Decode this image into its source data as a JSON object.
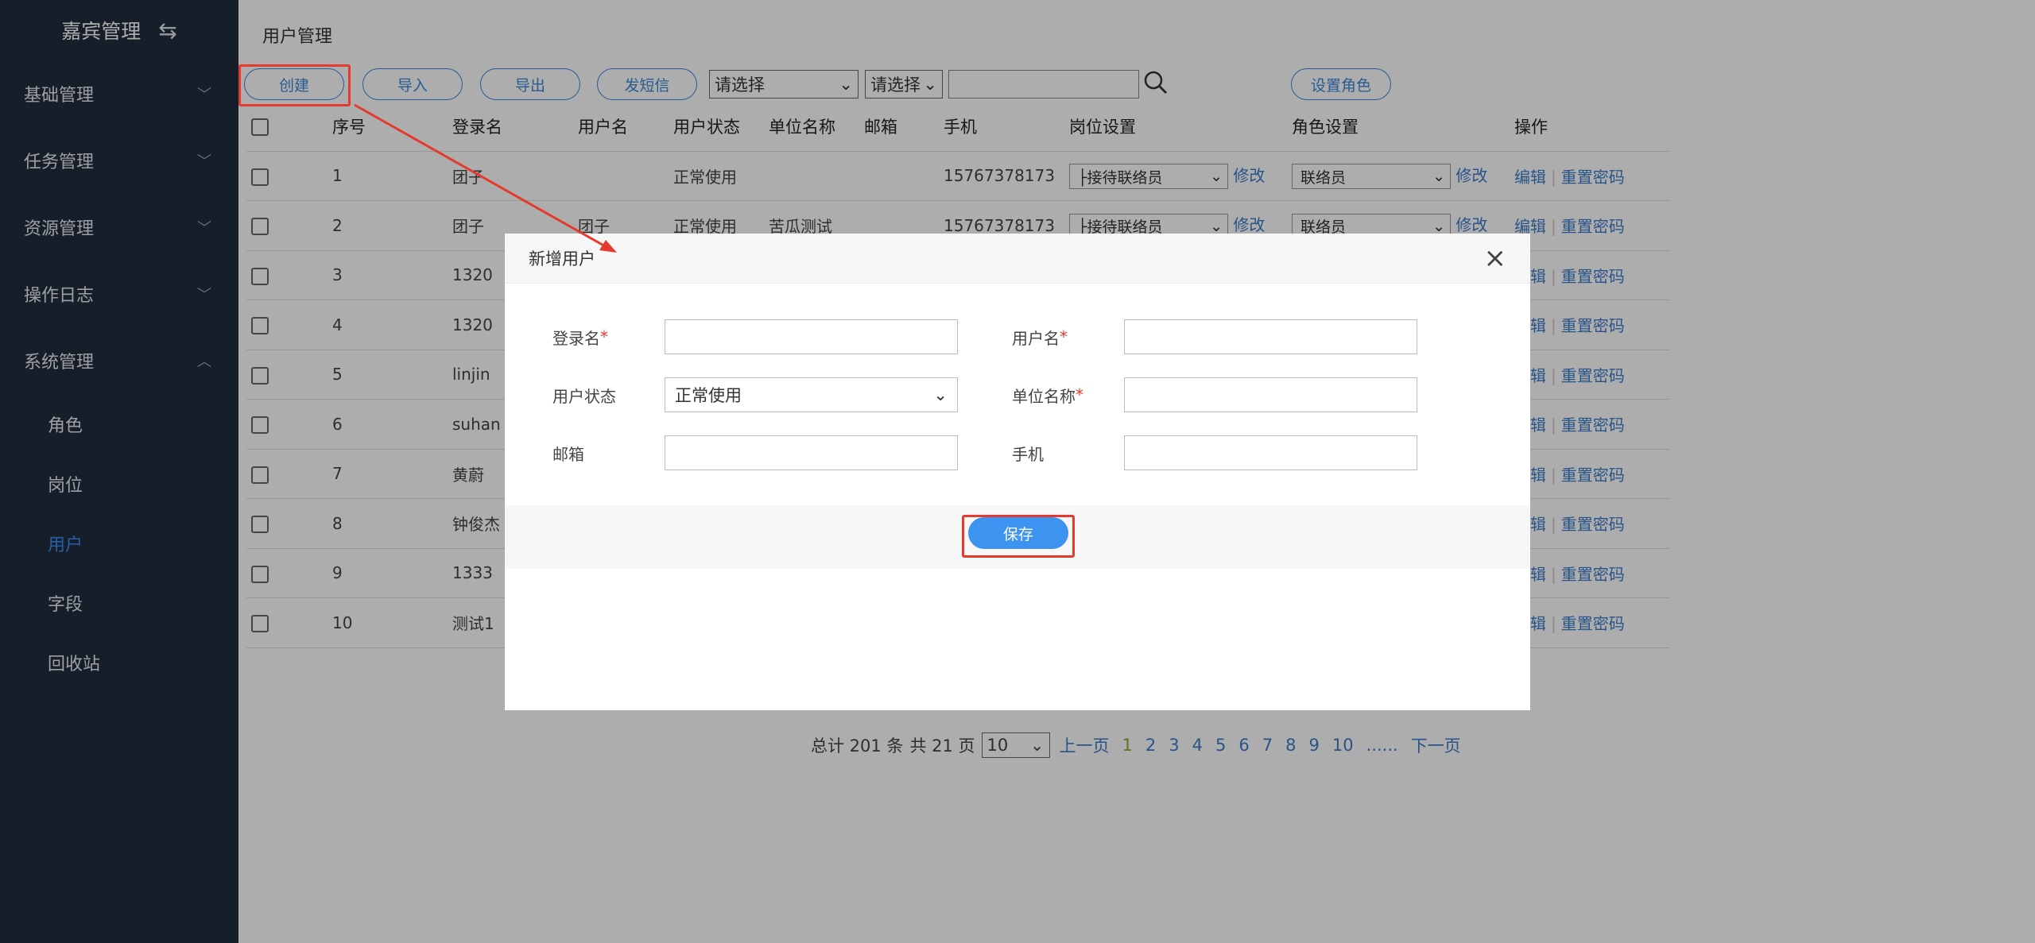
{
  "sidebar": {
    "brand": "嘉宾管理",
    "brand_icon": "swap-icon",
    "menus": [
      {
        "label": "基础管理",
        "icon": "chevron-down-icon"
      },
      {
        "label": "任务管理",
        "icon": "chevron-down-icon"
      },
      {
        "label": "资源管理",
        "icon": "chevron-down-icon"
      },
      {
        "label": "操作日志",
        "icon": "chevron-down-icon"
      },
      {
        "label": "系统管理",
        "icon": "chevron-up-icon"
      }
    ],
    "submenu": [
      "角色",
      "岗位",
      "用户",
      "字段",
      "回收站"
    ],
    "active_submenu": "用户",
    "active_color": "#3d8cf5"
  },
  "page": {
    "title": "用户管理"
  },
  "toolbar": {
    "create": "创建",
    "import": "导入",
    "export": "导出",
    "sms": "发短信",
    "select1": "请选择",
    "select2": "请选择",
    "search_value": "",
    "set_role": "设置角色"
  },
  "table": {
    "headers": [
      "序号",
      "登录名",
      "用户名",
      "用户状态",
      "单位名称",
      "邮箱",
      "手机",
      "岗位设置",
      "角色设置",
      "操作"
    ],
    "rows": [
      {
        "no": "1",
        "login": "团子",
        "name": "",
        "status": "正常使用",
        "unit": "",
        "email": "",
        "phone": "15767378173",
        "post": "├接待联络员",
        "role": "联络员"
      },
      {
        "no": "2",
        "login": "团子",
        "name": "团子",
        "status": "正常使用",
        "unit": "苦瓜测试",
        "email": "",
        "phone": "15767378173",
        "post": "├接待联络员",
        "role": "联络员"
      },
      {
        "no": "3",
        "login": "1320",
        "name": "",
        "status": "",
        "unit": "",
        "email": "",
        "phone": "",
        "post": "",
        "role": ""
      },
      {
        "no": "4",
        "login": "1320",
        "name": "",
        "status": "",
        "unit": "",
        "email": "",
        "phone": "",
        "post": "",
        "role": ""
      },
      {
        "no": "5",
        "login": "linjin",
        "name": "",
        "status": "",
        "unit": "",
        "email": "",
        "phone": "",
        "post": "",
        "role": ""
      },
      {
        "no": "6",
        "login": "suhan",
        "name": "",
        "status": "",
        "unit": "",
        "email": "",
        "phone": "",
        "post": "",
        "role": ""
      },
      {
        "no": "7",
        "login": "黄蔚",
        "name": "",
        "status": "",
        "unit": "",
        "email": "",
        "phone": "",
        "post": "",
        "role": ""
      },
      {
        "no": "8",
        "login": "钟俊杰",
        "name": "",
        "status": "",
        "unit": "",
        "email": "",
        "phone": "",
        "post": "",
        "role": ""
      },
      {
        "no": "9",
        "login": "1333",
        "name": "",
        "status": "",
        "unit": "",
        "email": "",
        "phone": "",
        "post": "",
        "role": ""
      },
      {
        "no": "10",
        "login": "测试1",
        "name": "",
        "status": "",
        "unit": "",
        "email": "",
        "phone": "",
        "post": "",
        "role": ""
      }
    ],
    "modify": "修改",
    "edit": "编辑",
    "reset_pwd": "重置密码"
  },
  "pager": {
    "total": "总计 201 条",
    "pages": "共 21 页",
    "page_size": "10",
    "prev": "上一页",
    "numbers": [
      "1",
      "2",
      "3",
      "4",
      "5",
      "6",
      "7",
      "8",
      "9",
      "10"
    ],
    "current": "1",
    "ellipsis": "......",
    "next": "下一页"
  },
  "dialog": {
    "title": "新增用户",
    "fields": {
      "login_label": "登录名",
      "username_label": "用户名",
      "status_label": "用户状态",
      "status_value": "正常使用",
      "unit_label": "单位名称",
      "email_label": "邮箱",
      "phone_label": "手机",
      "required_mark": "*"
    },
    "save": "保存"
  },
  "colors": {
    "sidebar_bg": "#1f2d3d",
    "accent": "#3d94f0",
    "annotation": "#e53a2e"
  }
}
